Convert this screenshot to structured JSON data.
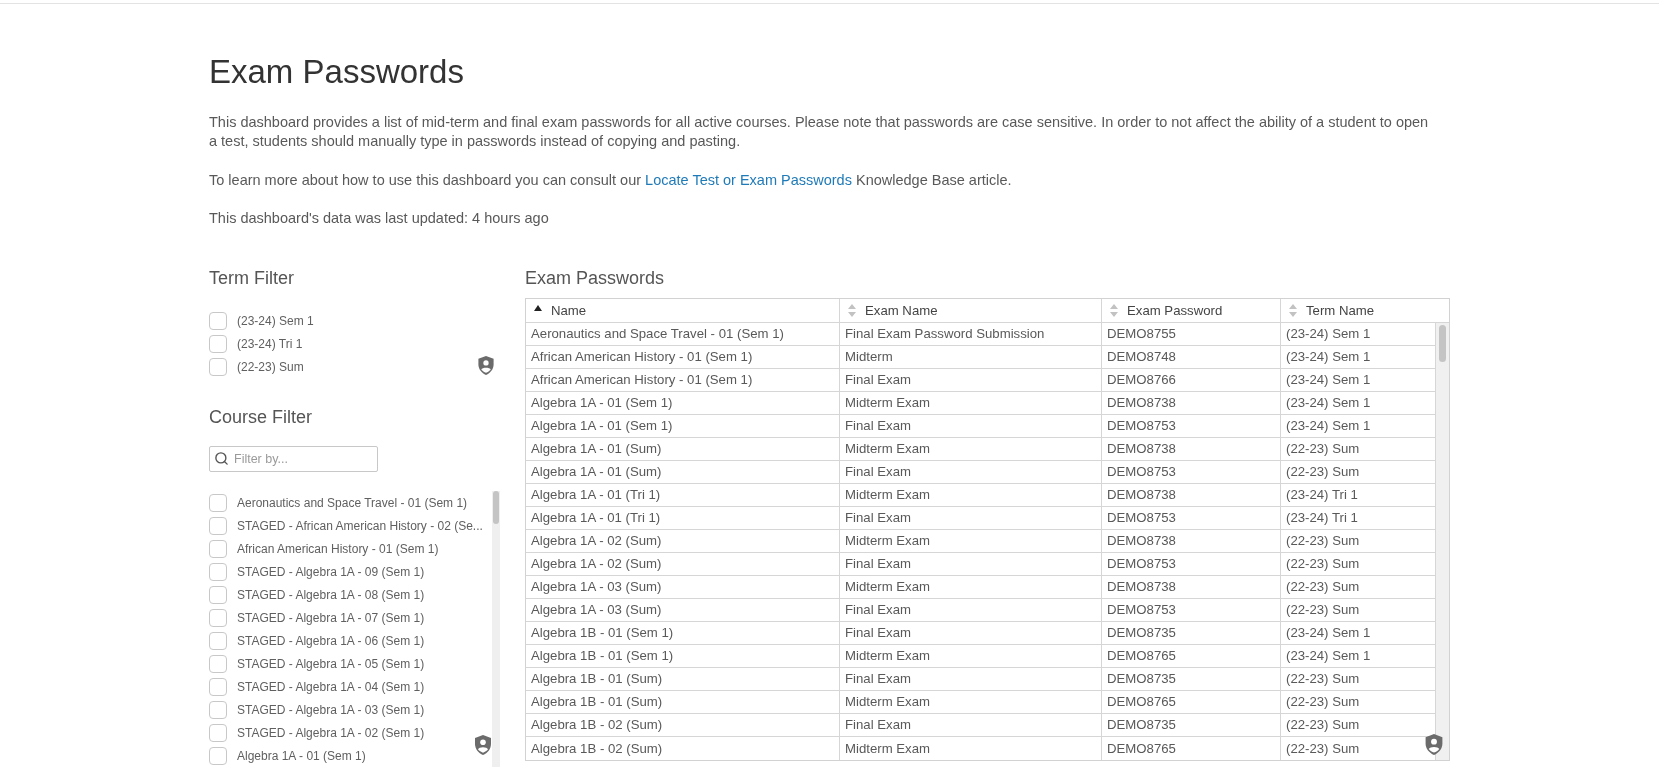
{
  "page": {
    "title": "Exam Passwords",
    "description": "This dashboard provides a list of mid-term and final exam passwords for all active courses. Please note that passwords are case sensitive. In order to not affect the ability of a student to open a test, students should manually type in passwords instead of copying and pasting.",
    "help_text": {
      "before": "To learn more about how to use this dashboard you can consult our ",
      "link": "Locate Test or Exam Passwords",
      "after": " Knowledge Base article."
    },
    "last_updated": "This dashboard's data was last updated: 4 hours ago"
  },
  "term_filter": {
    "title": "Term Filter",
    "items": [
      {
        "label": "(23-24) Sem 1",
        "checked": false
      },
      {
        "label": "(23-24) Tri 1",
        "checked": false
      },
      {
        "label": "(22-23) Sum",
        "checked": false
      }
    ]
  },
  "course_filter": {
    "title": "Course Filter",
    "search": {
      "placeholder": "Filter by..."
    },
    "items": [
      {
        "label": "Aeronautics and Space Travel - 01 (Sem 1)",
        "checked": false
      },
      {
        "label": "STAGED - African American History - 02 (Se...",
        "checked": false
      },
      {
        "label": "African American History - 01 (Sem 1)",
        "checked": false
      },
      {
        "label": "STAGED - Algebra 1A - 09 (Sem 1)",
        "checked": false
      },
      {
        "label": "STAGED - Algebra 1A - 08 (Sem 1)",
        "checked": false
      },
      {
        "label": "STAGED - Algebra 1A - 07 (Sem 1)",
        "checked": false
      },
      {
        "label": "STAGED - Algebra 1A - 06 (Sem 1)",
        "checked": false
      },
      {
        "label": "STAGED - Algebra 1A - 05 (Sem 1)",
        "checked": false
      },
      {
        "label": "STAGED - Algebra 1A - 04 (Sem 1)",
        "checked": false
      },
      {
        "label": "STAGED - Algebra 1A - 03 (Sem 1)",
        "checked": false
      },
      {
        "label": "STAGED - Algebra 1A - 02 (Sem 1)",
        "checked": false
      },
      {
        "label": "Algebra 1A - 01 (Sem 1)",
        "checked": false
      }
    ]
  },
  "table": {
    "title": "Exam Passwords",
    "columns": [
      {
        "label": "Name",
        "sorted": true
      },
      {
        "label": "Exam Name",
        "sorted": false
      },
      {
        "label": "Exam Password",
        "sorted": false
      },
      {
        "label": "Term Name",
        "sorted": false
      }
    ],
    "rows": [
      [
        "Aeronautics and Space Travel - 01 (Sem 1)",
        "Final Exam Password Submission",
        "DEMO8755",
        "(23-24) Sem 1"
      ],
      [
        "African American History - 01 (Sem 1)",
        "Midterm",
        "DEMO8748",
        "(23-24) Sem 1"
      ],
      [
        "African American History - 01 (Sem 1)",
        "Final Exam",
        "DEMO8766",
        "(23-24) Sem 1"
      ],
      [
        "Algebra 1A - 01 (Sem 1)",
        "Midterm Exam",
        "DEMO8738",
        "(23-24) Sem 1"
      ],
      [
        "Algebra 1A - 01 (Sem 1)",
        "Final Exam",
        "DEMO8753",
        "(23-24) Sem 1"
      ],
      [
        "Algebra 1A - 01 (Sum)",
        "Midterm Exam",
        "DEMO8738",
        "(22-23) Sum"
      ],
      [
        "Algebra 1A - 01 (Sum)",
        "Final Exam",
        "DEMO8753",
        "(22-23) Sum"
      ],
      [
        "Algebra 1A - 01 (Tri 1)",
        "Midterm Exam",
        "DEMO8738",
        "(23-24) Tri 1"
      ],
      [
        "Algebra 1A - 01 (Tri 1)",
        "Final Exam",
        "DEMO8753",
        "(23-24) Tri 1"
      ],
      [
        "Algebra 1A - 02 (Sum)",
        "Midterm Exam",
        "DEMO8738",
        "(22-23) Sum"
      ],
      [
        "Algebra 1A - 02 (Sum)",
        "Final Exam",
        "DEMO8753",
        "(22-23) Sum"
      ],
      [
        "Algebra 1A - 03 (Sum)",
        "Midterm Exam",
        "DEMO8738",
        "(22-23) Sum"
      ],
      [
        "Algebra 1A - 03 (Sum)",
        "Final Exam",
        "DEMO8753",
        "(22-23) Sum"
      ],
      [
        "Algebra 1B - 01 (Sem 1)",
        "Final Exam",
        "DEMO8735",
        "(23-24) Sem 1"
      ],
      [
        "Algebra 1B - 01 (Sem 1)",
        "Midterm Exam",
        "DEMO8765",
        "(23-24) Sem 1"
      ],
      [
        "Algebra 1B - 01 (Sum)",
        "Final Exam",
        "DEMO8735",
        "(22-23) Sum"
      ],
      [
        "Algebra 1B - 01 (Sum)",
        "Midterm Exam",
        "DEMO8765",
        "(22-23) Sum"
      ],
      [
        "Algebra 1B - 02 (Sum)",
        "Final Exam",
        "DEMO8735",
        "(22-23) Sum"
      ],
      [
        "Algebra 1B - 02 (Sum)",
        "Midterm Exam",
        "DEMO8765",
        "(22-23) Sum"
      ]
    ]
  }
}
